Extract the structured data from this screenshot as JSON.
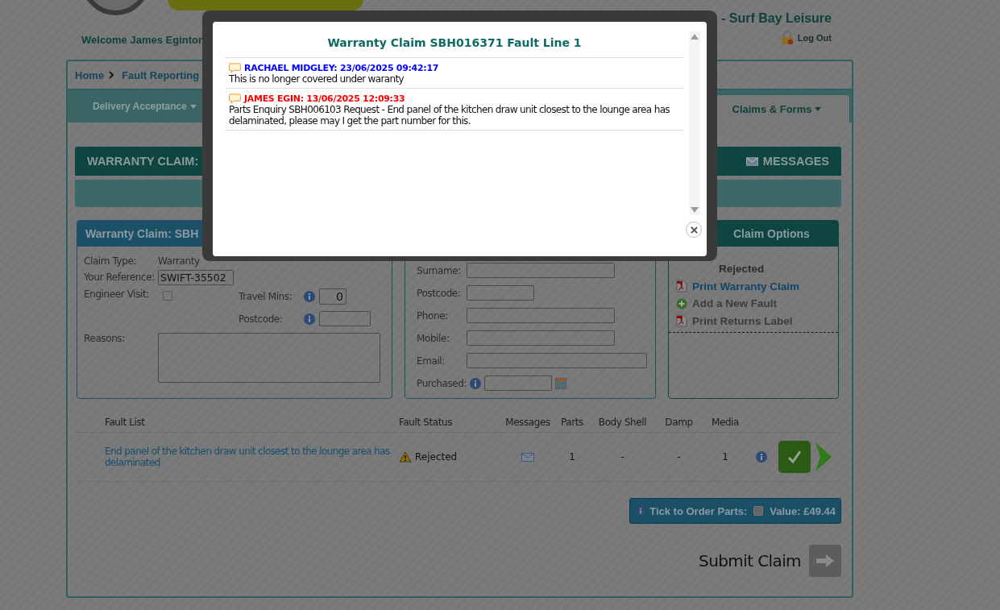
{
  "header": {
    "welcome": "Welcome James Eginton",
    "dealer": "- Surf Bay Leisure",
    "logout": "Log Out"
  },
  "breadcrumb": [
    {
      "label": "Home"
    },
    {
      "label": "Fault Reporting"
    }
  ],
  "nav_tabs": [
    {
      "label": "Delivery Acceptance",
      "selected": false
    },
    {
      "label": "Claims & Forms",
      "selected": true
    }
  ],
  "claim_bar": {
    "title": "WARRANTY CLAIM:",
    "messages": "MESSAGES"
  },
  "claim_panel": {
    "title": "Warranty Claim: SBH",
    "claim_type_label": "Claim Type:",
    "claim_type": "Warranty",
    "reference_label": "Your Reference:",
    "reference": "SWIFT-35502",
    "engineer_visit_label": "Engineer Visit:",
    "engineer_visit": false,
    "travel_label": "Travel Mins:",
    "travel": "0",
    "postcode_label": "Postcode:",
    "reasons_label": "Reasons:"
  },
  "customer_panel": {
    "fields": [
      {
        "label": "Surname:",
        "kind": "wide"
      },
      {
        "label": "Postcode:",
        "kind": "short"
      },
      {
        "label": "Phone:",
        "kind": "wide"
      },
      {
        "label": "Mobile:",
        "kind": "wide"
      },
      {
        "label": "Email:",
        "kind": "full"
      },
      {
        "label": "Purchased:",
        "kind": "date"
      }
    ]
  },
  "options_panel": {
    "title": "Claim Options",
    "status": "Rejected",
    "actions": [
      {
        "label": "Print Warranty Claim",
        "kind": "pdf",
        "disabled": false
      },
      {
        "label": "Add a New Fault",
        "kind": "add",
        "disabled": true
      },
      {
        "label": "Print Returns Label",
        "kind": "pdf",
        "disabled": true
      }
    ]
  },
  "fault_table": {
    "columns": [
      "Fault List",
      "Fault Status",
      "Messages",
      "Parts",
      "Body Shell",
      "Damp",
      "Media"
    ],
    "rows": [
      {
        "description": "End panel of the kitchen draw unit closest to the lounge area has delaminated",
        "status": "Rejected",
        "parts": "1",
        "body_shell": "-",
        "damp": "-",
        "media": "1"
      }
    ]
  },
  "order_parts": {
    "label": "Tick to Order Parts:",
    "checked": false,
    "value": "Value: £49.44"
  },
  "submit": "Submit Claim",
  "modal": {
    "title": "Warranty Claim SBH016371 Fault Line 1",
    "messages": [
      {
        "author": "RACHAEL MIDGLEY: 23/06/2025 09:42:17",
        "color": "#0000ff",
        "text": "This is no longer covered under waranty"
      },
      {
        "author": "JAMES EGIN: 13/06/2025 12:09:33",
        "color": "#ff0000",
        "text": "Parts Enquiry SBH006103 Request - End panel of the kitchen draw unit closest to the lounge area has delaminated, please may I get the part number for this."
      }
    ]
  }
}
